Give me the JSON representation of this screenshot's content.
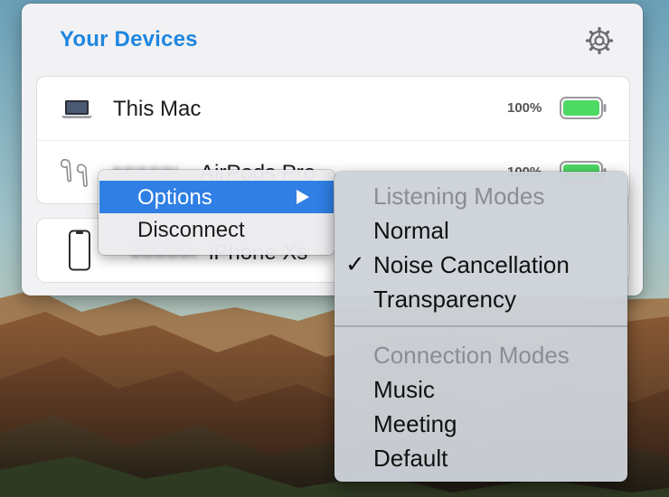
{
  "panel": {
    "title": "Your Devices",
    "settings_icon": "gear-icon",
    "devices": [
      {
        "name": "This Mac",
        "icon": "laptop-icon",
        "battery": "100%",
        "battery_level": 1.0,
        "battery_color": "#4cd964"
      },
      {
        "name": "AirPods Pro",
        "icon": "airpods-icon",
        "battery": "100%",
        "battery_level": 1.0,
        "battery_color": "#4cd964"
      },
      {
        "name": "iPhone Xs",
        "icon": "iphone-icon"
      }
    ],
    "accent_color": "#1f86e0"
  },
  "context_menu": {
    "items": [
      {
        "label": "Options",
        "selected": true,
        "submenu_icon": "triangle-right-icon"
      },
      {
        "label": "Disconnect",
        "selected": false
      }
    ],
    "highlight_color": "#2f7fe5"
  },
  "submenu": {
    "listening_header": "Listening Modes",
    "listening_modes": [
      {
        "label": "Normal",
        "checked": false
      },
      {
        "label": "Noise Cancellation",
        "checked": true
      },
      {
        "label": "Transparency",
        "checked": false
      }
    ],
    "checkmark": "✓",
    "connection_header": "Connection Modes",
    "connection_modes": [
      {
        "label": "Music"
      },
      {
        "label": "Meeting"
      },
      {
        "label": "Default"
      }
    ]
  }
}
